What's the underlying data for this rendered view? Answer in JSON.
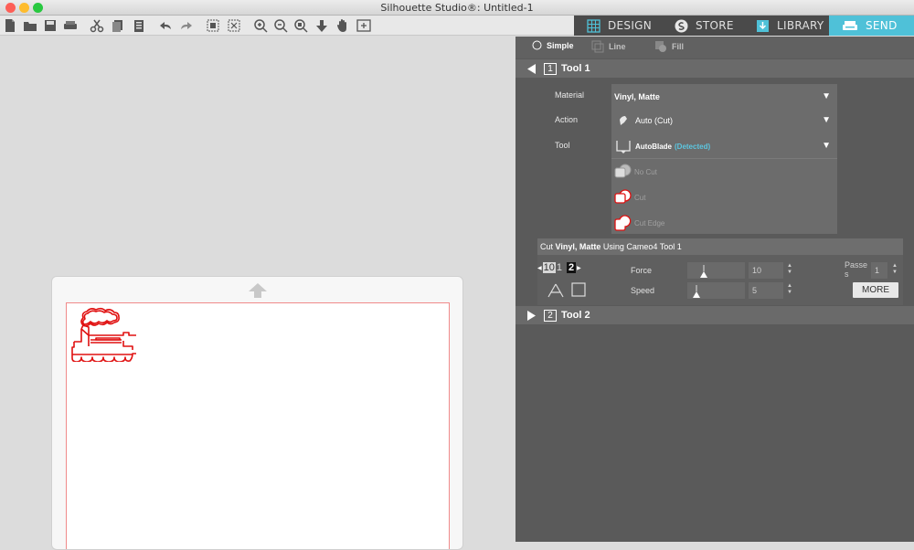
{
  "window": {
    "title": "Silhouette Studio®: Untitled-1"
  },
  "nav_tabs": [
    {
      "label": "DESIGN",
      "icon": "design-grid-icon"
    },
    {
      "label": "STORE",
      "icon": "store-icon"
    },
    {
      "label": "LIBRARY",
      "icon": "library-icon"
    },
    {
      "label": "SEND",
      "icon": "send-icon",
      "active": true
    }
  ],
  "send_modes": [
    {
      "label": "Simple",
      "selected": true
    },
    {
      "label": "Line"
    },
    {
      "label": "Fill"
    }
  ],
  "tool1": {
    "number": "1",
    "title": "Tool 1",
    "material_label": "Material",
    "material_value": "Vinyl, Matte",
    "action_label": "Action",
    "action_value": "Auto (Cut)",
    "tool_label": "Tool",
    "tool_value": "AutoBlade",
    "tool_status": "(Detected)",
    "cut_options": [
      "No Cut",
      "Cut",
      "Cut Edge"
    ],
    "summary_prefix": "Cut ",
    "summary_material": "Vinyl, Matte",
    "summary_suffix": " Using Cameo4 Tool 1",
    "blade_depth": "10",
    "blade_depth_next": "1",
    "blade_alt": "2",
    "force_label": "Force",
    "force_value": "10",
    "speed_label": "Speed",
    "speed_value": "5",
    "passes_label_1": "Passe",
    "passes_label_2": "s",
    "passes_value": "1",
    "more_label": "MORE"
  },
  "tool2": {
    "number": "2",
    "title": "Tool 2"
  },
  "colors": {
    "send_accent": "#4fc1d8",
    "cut_line": "#e01010",
    "panel_bg": "#5a5a5a"
  }
}
